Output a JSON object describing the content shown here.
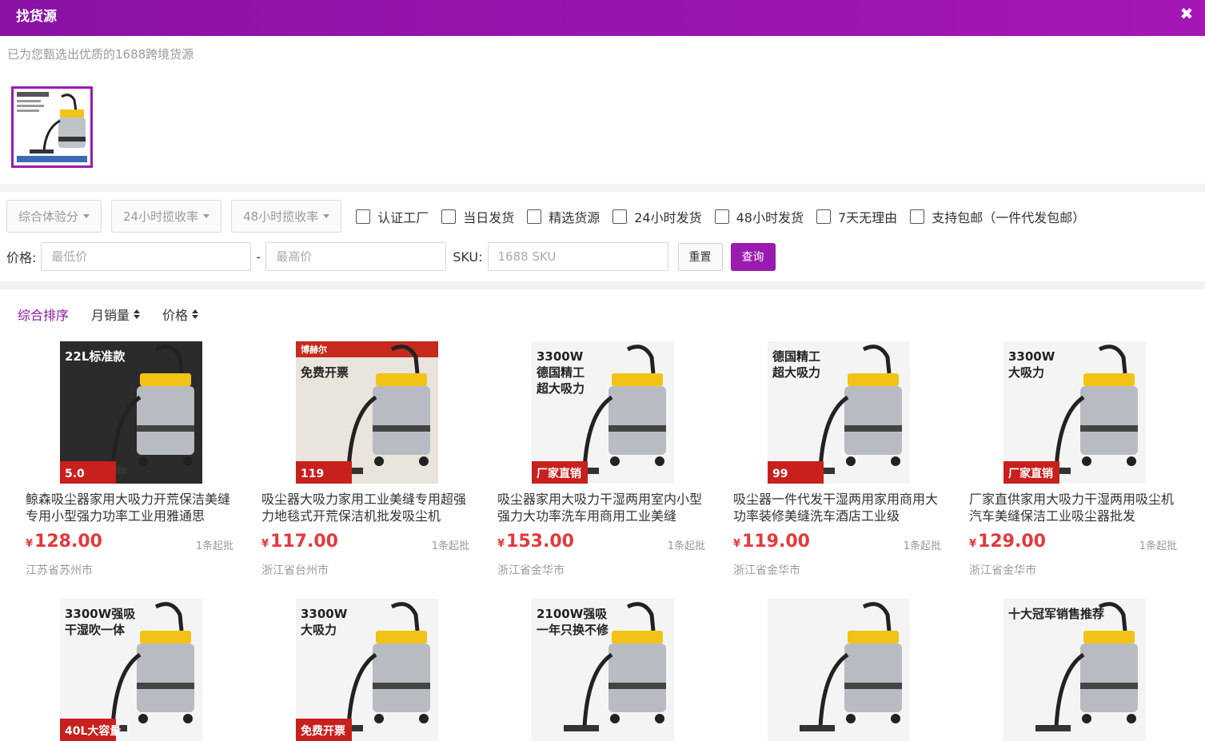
{
  "header": {
    "title": "找货源",
    "close_icon": "close-icon"
  },
  "subtitle": "已为您甄选出优质的1688跨境货源",
  "source_image": {
    "name": "source-product-thumbnail",
    "icon": "vacuum-cleaner-image"
  },
  "filters": {
    "dropdowns": [
      "综合体验分",
      "24小时揽收率",
      "48小时揽收率"
    ],
    "checkboxes": [
      "认证工厂",
      "当日发货",
      "精选货源",
      "24小时发货",
      "48小时发货",
      "7天无理由",
      "支持包邮（一件代发包邮）"
    ]
  },
  "price_filter": {
    "label": "价格:",
    "min_placeholder": "最低价",
    "separator": "-",
    "max_placeholder": "最高价",
    "sku_label": "SKU:",
    "sku_placeholder": "1688 SKU",
    "reset_label": "重置",
    "query_label": "查询"
  },
  "sort": {
    "items": [
      "综合排序",
      "月销量",
      "价格"
    ],
    "active": "综合排序"
  },
  "colors": {
    "brand": "#9a1bb0",
    "price": "#e4393c"
  },
  "products": [
    {
      "title": "鲸森吸尘器家用大吸力开荒保洁美缝专用小型强力功率工业用雅通思",
      "currency": "¥",
      "price": "128.00",
      "moq": "1条起批",
      "location": "江苏省苏州市",
      "img": {
        "bg": "#2b2b2b",
        "left": "22L标准款",
        "badge": "5.0"
      }
    },
    {
      "title": "吸尘器大吸力家用工业美缝专用超强力地毯式开荒保洁机批发吸尘机",
      "currency": "¥",
      "price": "117.00",
      "moq": "1条起批",
      "location": "浙江省台州市",
      "img": {
        "bg": "#c52a1c",
        "left": "博赫尔 免费开票",
        "badge": "119"
      }
    },
    {
      "title": "吸尘器家用大吸力干湿两用室内小型强力大功率洗车用商用工业美缝",
      "currency": "¥",
      "price": "153.00",
      "moq": "1条起批",
      "location": "浙江省金华市",
      "img": {
        "bg": "#fff",
        "left": "3300W 德国精工 超大吸力",
        "badge": "厂家直销"
      }
    },
    {
      "title": "吸尘器一件代发干湿两用家用商用大功率装修美缝洗车酒店工业级",
      "currency": "¥",
      "price": "119.00",
      "moq": "1条起批",
      "location": "浙江省金华市",
      "img": {
        "bg": "#fff",
        "left": "德国精工 超大吸力",
        "badge": "99"
      }
    },
    {
      "title": "厂家直供家用大吸力干湿两用吸尘机 汽车美缝保洁工业吸尘器批发",
      "currency": "¥",
      "price": "129.00",
      "moq": "1条起批",
      "location": "浙江省金华市",
      "img": {
        "bg": "#fff",
        "left": "3300W 大吸力",
        "badge": "厂家直销"
      }
    },
    {
      "img": {
        "bg": "#fff",
        "left": "3300W强吸 干湿吹一体",
        "badge": "40L大容量"
      }
    },
    {
      "img": {
        "bg": "#fff",
        "left": "3300W 大吸力",
        "badge": "免费开票"
      }
    },
    {
      "img": {
        "bg": "#fff",
        "left": "2100W强吸 一年只换不修",
        "badge": ""
      }
    },
    {
      "img": {
        "bg": "#fff",
        "left": "",
        "badge": ""
      }
    },
    {
      "img": {
        "bg": "#fff",
        "left": "十大冠军销售推荐",
        "badge": ""
      }
    }
  ]
}
